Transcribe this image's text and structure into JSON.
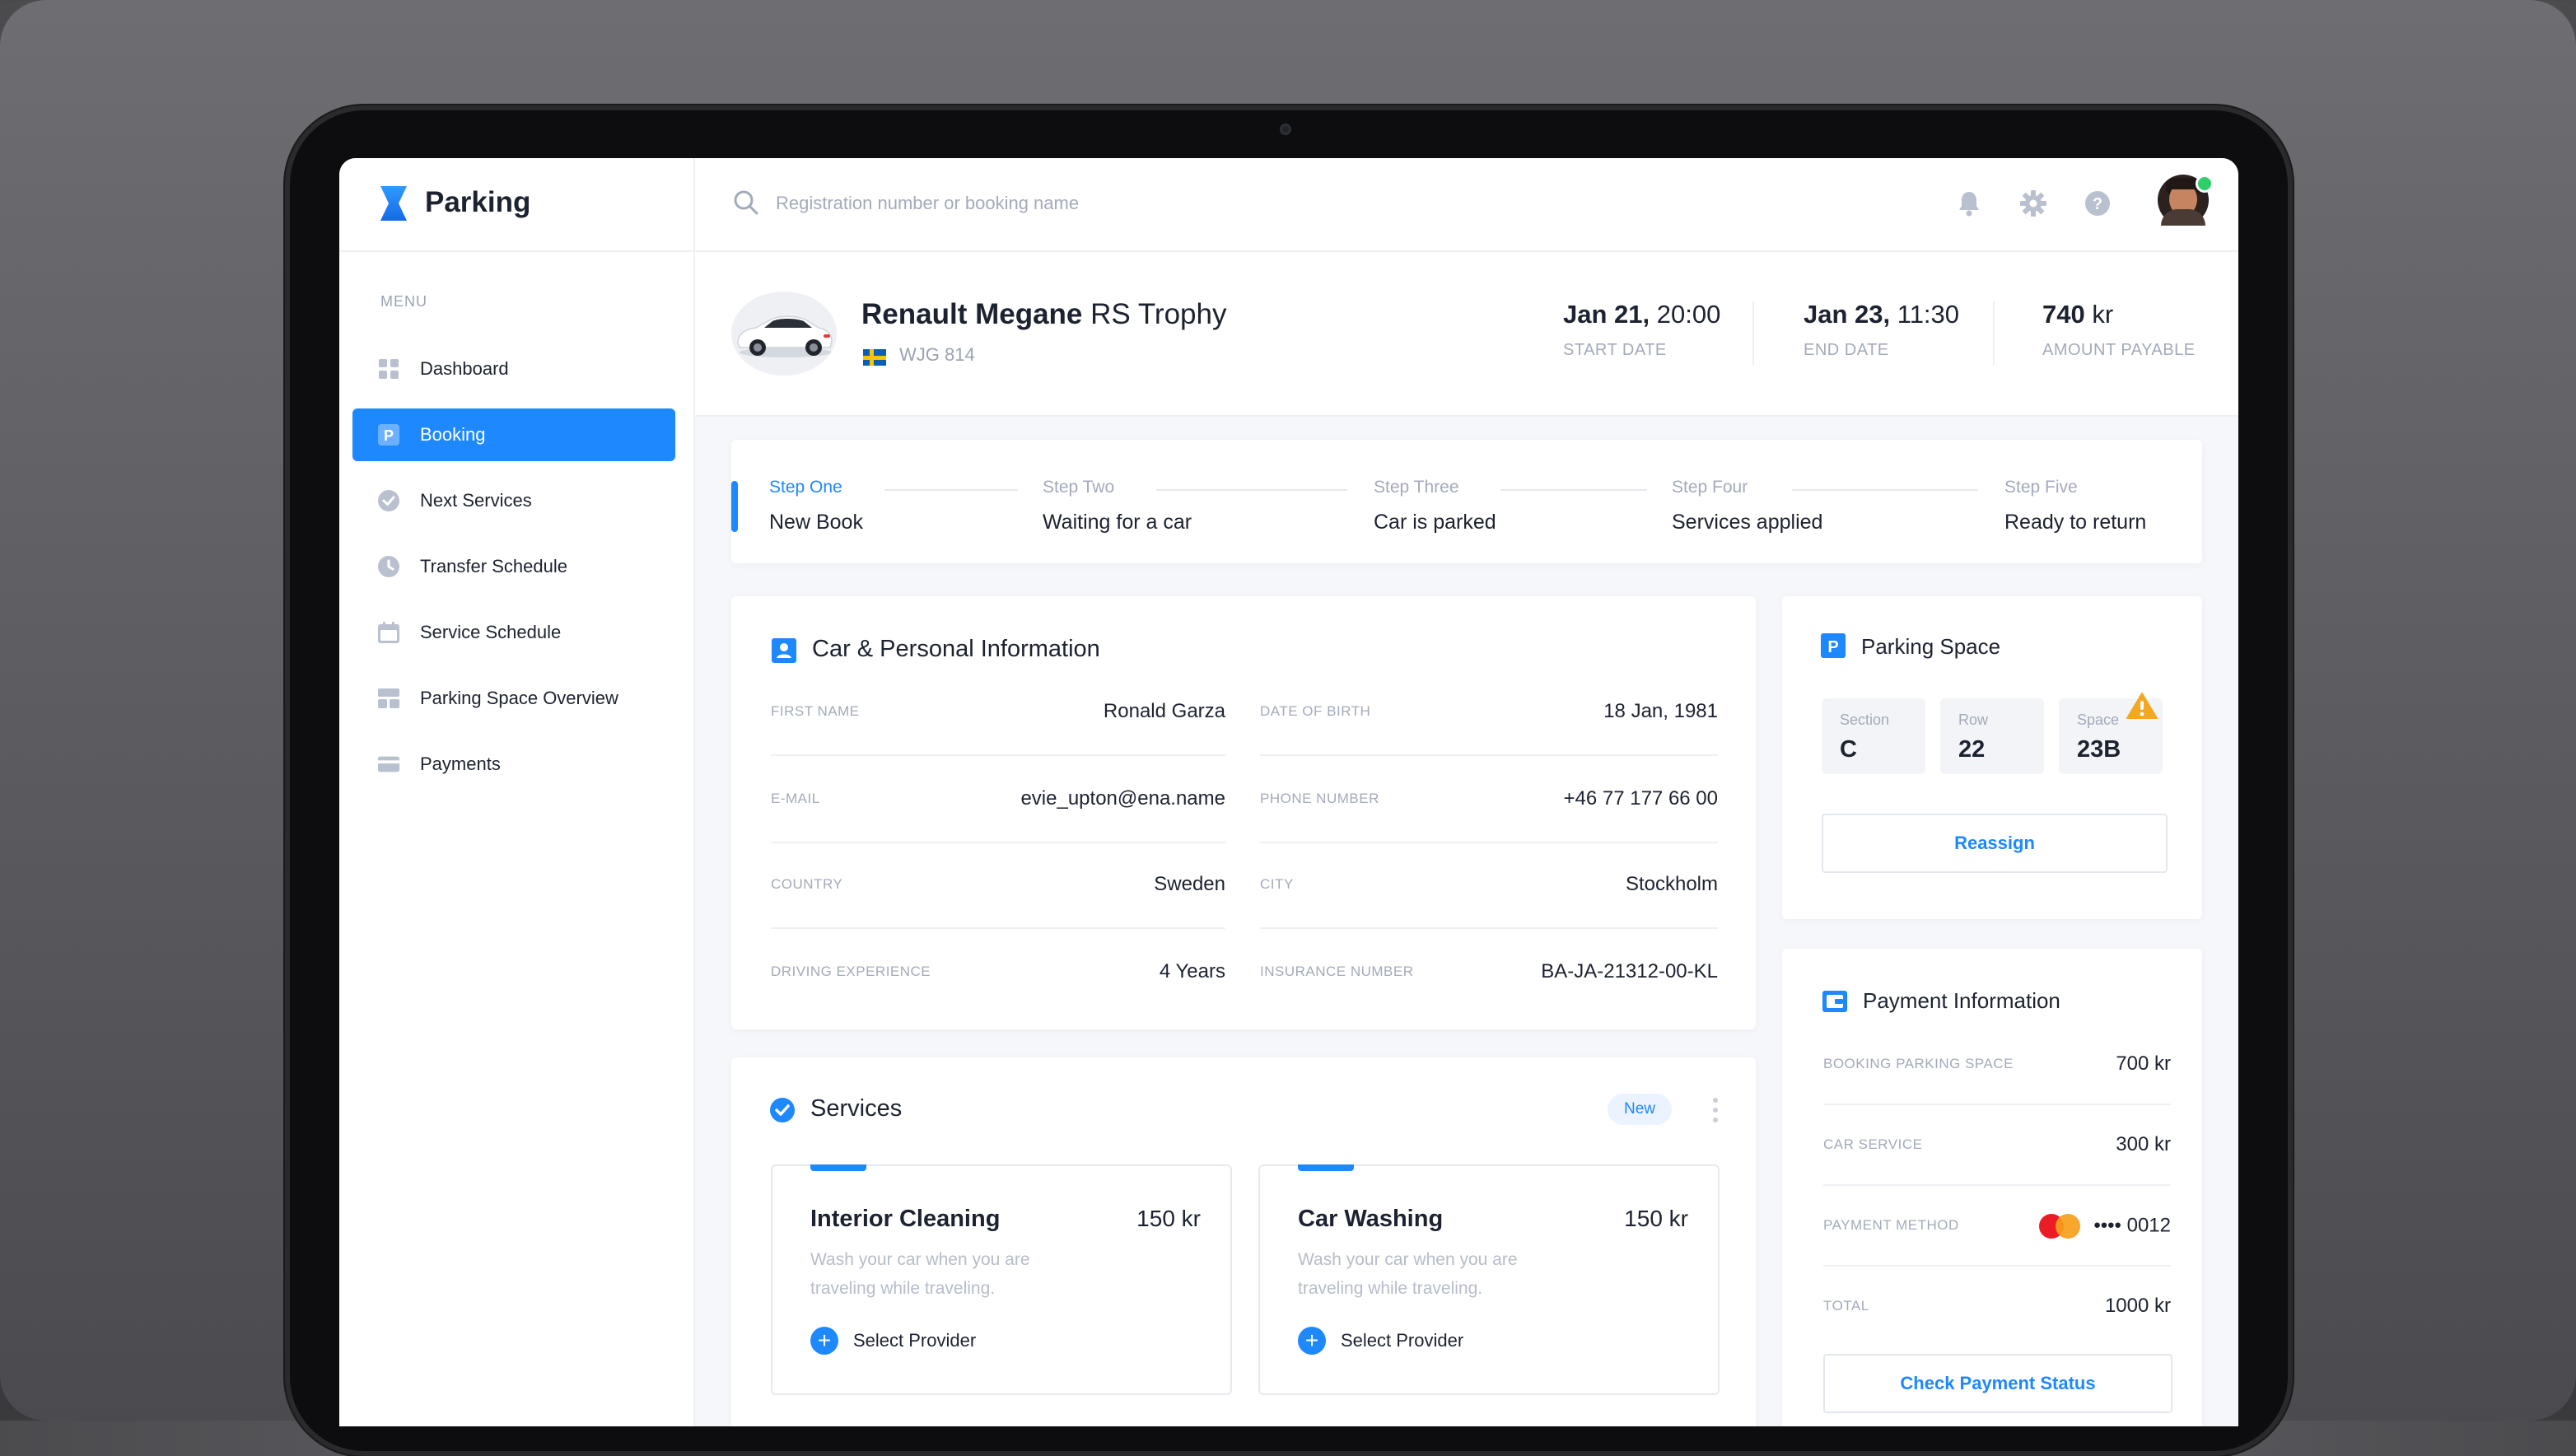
{
  "app": {
    "name": "Parking"
  },
  "sidebar": {
    "menu_label": "MENU",
    "items": [
      {
        "label": "Dashboard",
        "icon": "dashboard-icon",
        "active": false
      },
      {
        "label": "Booking",
        "icon": "parking-icon",
        "active": true
      },
      {
        "label": "Next Services",
        "icon": "check-circle-icon",
        "active": false
      },
      {
        "label": "Transfer Schedule",
        "icon": "clock-icon",
        "active": false
      },
      {
        "label": "Service Schedule",
        "icon": "calendar-icon",
        "active": false
      },
      {
        "label": "Parking Space Overview",
        "icon": "layout-icon",
        "active": false
      },
      {
        "label": "Payments",
        "icon": "credit-card-icon",
        "active": false
      }
    ]
  },
  "search": {
    "placeholder": "Registration number or booking name",
    "value": ""
  },
  "header": {
    "car_brand": "Renault Megane",
    "car_model": "RS Trophy",
    "plate": "WJG 814",
    "start_date_day": "Jan 21,",
    "start_date_time": "20:00",
    "start_date_label": "START DATE",
    "end_date_day": "Jan 23,",
    "end_date_time": "11:30",
    "end_date_label": "END DATE",
    "amount_value": "740",
    "amount_unit": "kr",
    "amount_label": "AMOUNT PAYABLE"
  },
  "steps": [
    {
      "label": "Step One",
      "value": "New Book",
      "active": true
    },
    {
      "label": "Step Two",
      "value": "Waiting for a car",
      "active": false
    },
    {
      "label": "Step Three",
      "value": "Car is parked",
      "active": false
    },
    {
      "label": "Step Four",
      "value": "Services applied",
      "active": false
    },
    {
      "label": "Step Five",
      "value": "Ready to return",
      "active": false
    }
  ],
  "personal": {
    "title": "Car & Personal Information",
    "fields": [
      {
        "label": "FIRST NAME",
        "value": "Ronald Garza"
      },
      {
        "label": "DATE OF BIRTH",
        "value": "18 Jan, 1981"
      },
      {
        "label": "E-MAIL",
        "value": "evie_upton@ena.name"
      },
      {
        "label": "PHONE NUMBER",
        "value": "+46 77 177 66 00"
      },
      {
        "label": "COUNTRY",
        "value": "Sweden"
      },
      {
        "label": "CITY",
        "value": "Stockholm"
      },
      {
        "label": "DRIVING EXPERIENCE",
        "value": "4 Years"
      },
      {
        "label": "INSURANCE NUMBER",
        "value": "BA-JA-21312-00-KL"
      }
    ]
  },
  "services": {
    "title": "Services",
    "badge": "New",
    "items": [
      {
        "title": "Interior Cleaning",
        "price": "150 kr",
        "description": "Wash your car when you are traveling while traveling.",
        "action": "Select Provider"
      },
      {
        "title": "Car Washing",
        "price": "150 kr",
        "description": "Wash your car when you are traveling while traveling.",
        "action": "Select Provider"
      }
    ]
  },
  "parking_space": {
    "title": "Parking Space",
    "section_label": "Section",
    "section_value": "C",
    "row_label": "Row",
    "row_value": "22",
    "space_label": "Space",
    "space_value": "23B",
    "button": "Reassign"
  },
  "payment": {
    "title": "Payment Information",
    "rows": [
      {
        "label": "BOOKING PARKING SPACE",
        "value": "700 kr"
      },
      {
        "label": "CAR SERVICE",
        "value": "300 kr"
      },
      {
        "label": "PAYMENT METHOD",
        "value": "•••• 0012"
      },
      {
        "label": "TOTAL",
        "value": "1000 kr"
      }
    ],
    "button": "Check Payment Status"
  },
  "colors": {
    "accent": "#1e88ff",
    "warning": "#f5a623",
    "online": "#2ecf6b"
  }
}
